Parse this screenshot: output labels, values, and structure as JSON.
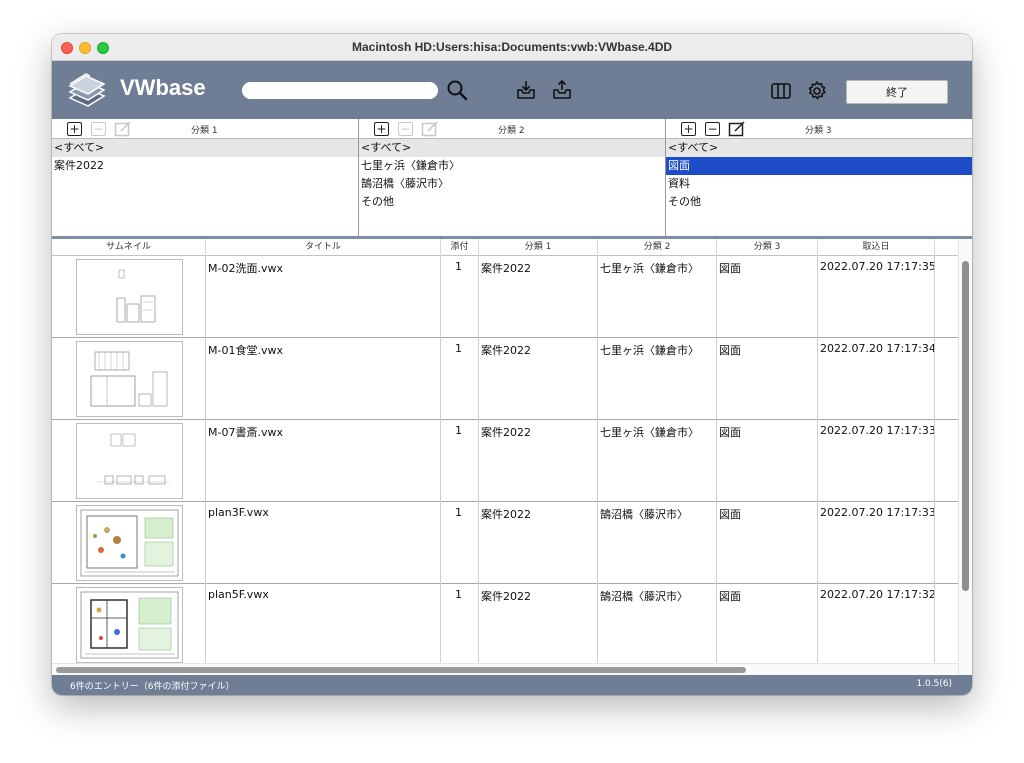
{
  "window": {
    "title": "Macintosh HD:Users:hisa:Documents:vwb:VWbase.4DD"
  },
  "toolbar": {
    "app_name": "VWbase",
    "search_value": "",
    "search_icon": "magnifier-icon",
    "import_icon": "tray-download-icon",
    "export_icon": "tray-upload-icon",
    "columns_icon": "columns-icon",
    "settings_icon": "gear-icon",
    "quit_label": "終了"
  },
  "categories": [
    {
      "title": "分類 1",
      "all": "<すべて>",
      "items": [
        "案件2022"
      ],
      "selected": null,
      "buttons_enabled": false
    },
    {
      "title": "分類 2",
      "all": "<すべて>",
      "items": [
        "七里ヶ浜〈鎌倉市〉",
        "鵠沼橋〈藤沢市〉",
        "その他"
      ],
      "selected": null,
      "buttons_enabled": false
    },
    {
      "title": "分類 3",
      "all": "<すべて>",
      "items": [
        "図面",
        "資料",
        "その他"
      ],
      "selected": "図面",
      "buttons_enabled": true
    }
  ],
  "table": {
    "headers": [
      "サムネイル",
      "タイトル",
      "添付",
      "分類 1",
      "分類 2",
      "分類 3",
      "取込日"
    ],
    "rows": [
      {
        "title": "M-02洗面.vwx",
        "attach": "1",
        "cat1": "案件2022",
        "cat2": "七里ヶ浜〈鎌倉市〉",
        "cat3": "図面",
        "date": "2022.07.20 17:17:35"
      },
      {
        "title": "M-01食堂.vwx",
        "attach": "1",
        "cat1": "案件2022",
        "cat2": "七里ヶ浜〈鎌倉市〉",
        "cat3": "図面",
        "date": "2022.07.20 17:17:34"
      },
      {
        "title": "M-07書斎.vwx",
        "attach": "1",
        "cat1": "案件2022",
        "cat2": "七里ヶ浜〈鎌倉市〉",
        "cat3": "図面",
        "date": "2022.07.20 17:17:33"
      },
      {
        "title": "plan3F.vwx",
        "attach": "1",
        "cat1": "案件2022",
        "cat2": "鵠沼橋〈藤沢市〉",
        "cat3": "図面",
        "date": "2022.07.20 17:17:33"
      },
      {
        "title": "plan5F.vwx",
        "attach": "1",
        "cat1": "案件2022",
        "cat2": "鵠沼橋〈藤沢市〉",
        "cat3": "図面",
        "date": "2022.07.20 17:17:32"
      }
    ]
  },
  "status": {
    "entries": "6件のエントリー（6件の添付ファイル）",
    "version": "1.0.5(6)"
  },
  "colors": {
    "toolbar": "#6f7e95",
    "selection": "#1e4bc8"
  }
}
